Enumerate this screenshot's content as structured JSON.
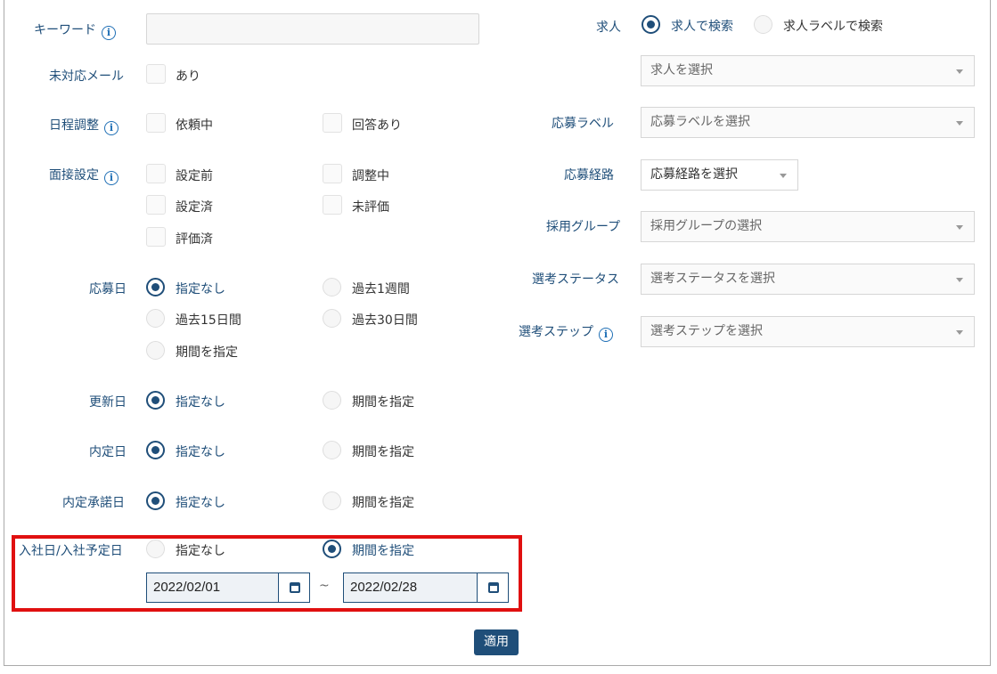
{
  "keyword": {
    "label": "キーワード",
    "value": ""
  },
  "unresponded": {
    "label": "未対応メール",
    "opt": "あり"
  },
  "schedule": {
    "label": "日程調整",
    "opts": [
      "依頼中",
      "回答あり"
    ]
  },
  "interview": {
    "label": "面接設定",
    "opts": [
      "設定前",
      "調整中",
      "設定済",
      "未評価",
      "評価済"
    ]
  },
  "applied_date": {
    "label": "応募日",
    "opts": [
      "指定なし",
      "過去1週間",
      "過去15日間",
      "過去30日間",
      "期間を指定"
    ]
  },
  "updated_date": {
    "label": "更新日",
    "opts": [
      "指定なし",
      "期間を指定"
    ]
  },
  "offer_date": {
    "label": "内定日",
    "opts": [
      "指定なし",
      "期間を指定"
    ]
  },
  "offer_accept_date": {
    "label": "内定承諾日",
    "opts": [
      "指定なし",
      "期間を指定"
    ]
  },
  "join_date": {
    "label": "入社日/入社予定日",
    "opts": [
      "指定なし",
      "期間を指定"
    ],
    "from": "2022/02/01",
    "sep": "~",
    "to": "2022/02/28"
  },
  "apply_button": "適用",
  "job": {
    "label": "求人",
    "opts": [
      "求人で検索",
      "求人ラベルで検索"
    ],
    "select_placeholder": "求人を選択"
  },
  "app_label": {
    "label": "応募ラベル",
    "placeholder": "応募ラベルを選択"
  },
  "app_route": {
    "label": "応募経路",
    "placeholder": "応募経路を選択"
  },
  "hiring_group": {
    "label": "採用グループ",
    "placeholder": "採用グループの選択"
  },
  "selection_status": {
    "label": "選考ステータス",
    "placeholder": "選考ステータスを選択"
  },
  "selection_step": {
    "label": "選考ステップ",
    "placeholder": "選考ステップを選択"
  },
  "info_glyph": "i",
  "colors": {
    "accent": "#1f4e79",
    "highlight": "#e01010"
  }
}
